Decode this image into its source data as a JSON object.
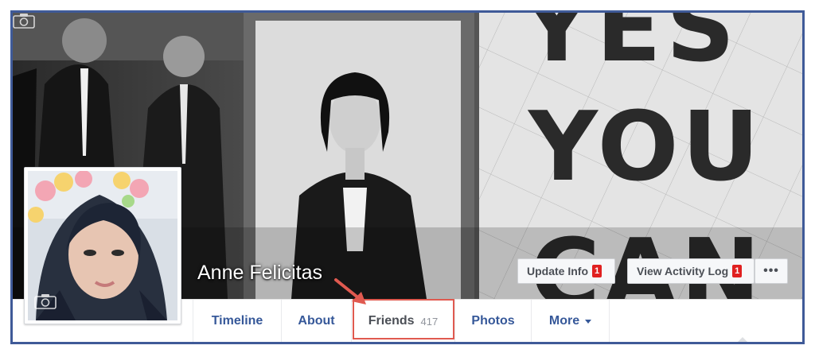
{
  "profile": {
    "name": "Anne Felicitas"
  },
  "actions": {
    "update_info_label": "Update Info",
    "update_info_badge": "1",
    "activity_log_label": "View Activity Log",
    "activity_log_badge": "1",
    "more_label": "•••"
  },
  "tabs": [
    {
      "label": "Timeline"
    },
    {
      "label": "About"
    },
    {
      "label": "Friends",
      "count": "417"
    },
    {
      "label": "Photos"
    },
    {
      "label": "More"
    }
  ],
  "colors": {
    "frame": "#3f5a98",
    "tab_link": "#365899",
    "highlight": "#e05a50",
    "badge": "#e02020"
  },
  "icons": {
    "cover_camera": "camera-icon",
    "avatar_camera": "camera-icon",
    "more_caret": "caret-down-icon",
    "annotation_arrow": "arrow-icon"
  }
}
